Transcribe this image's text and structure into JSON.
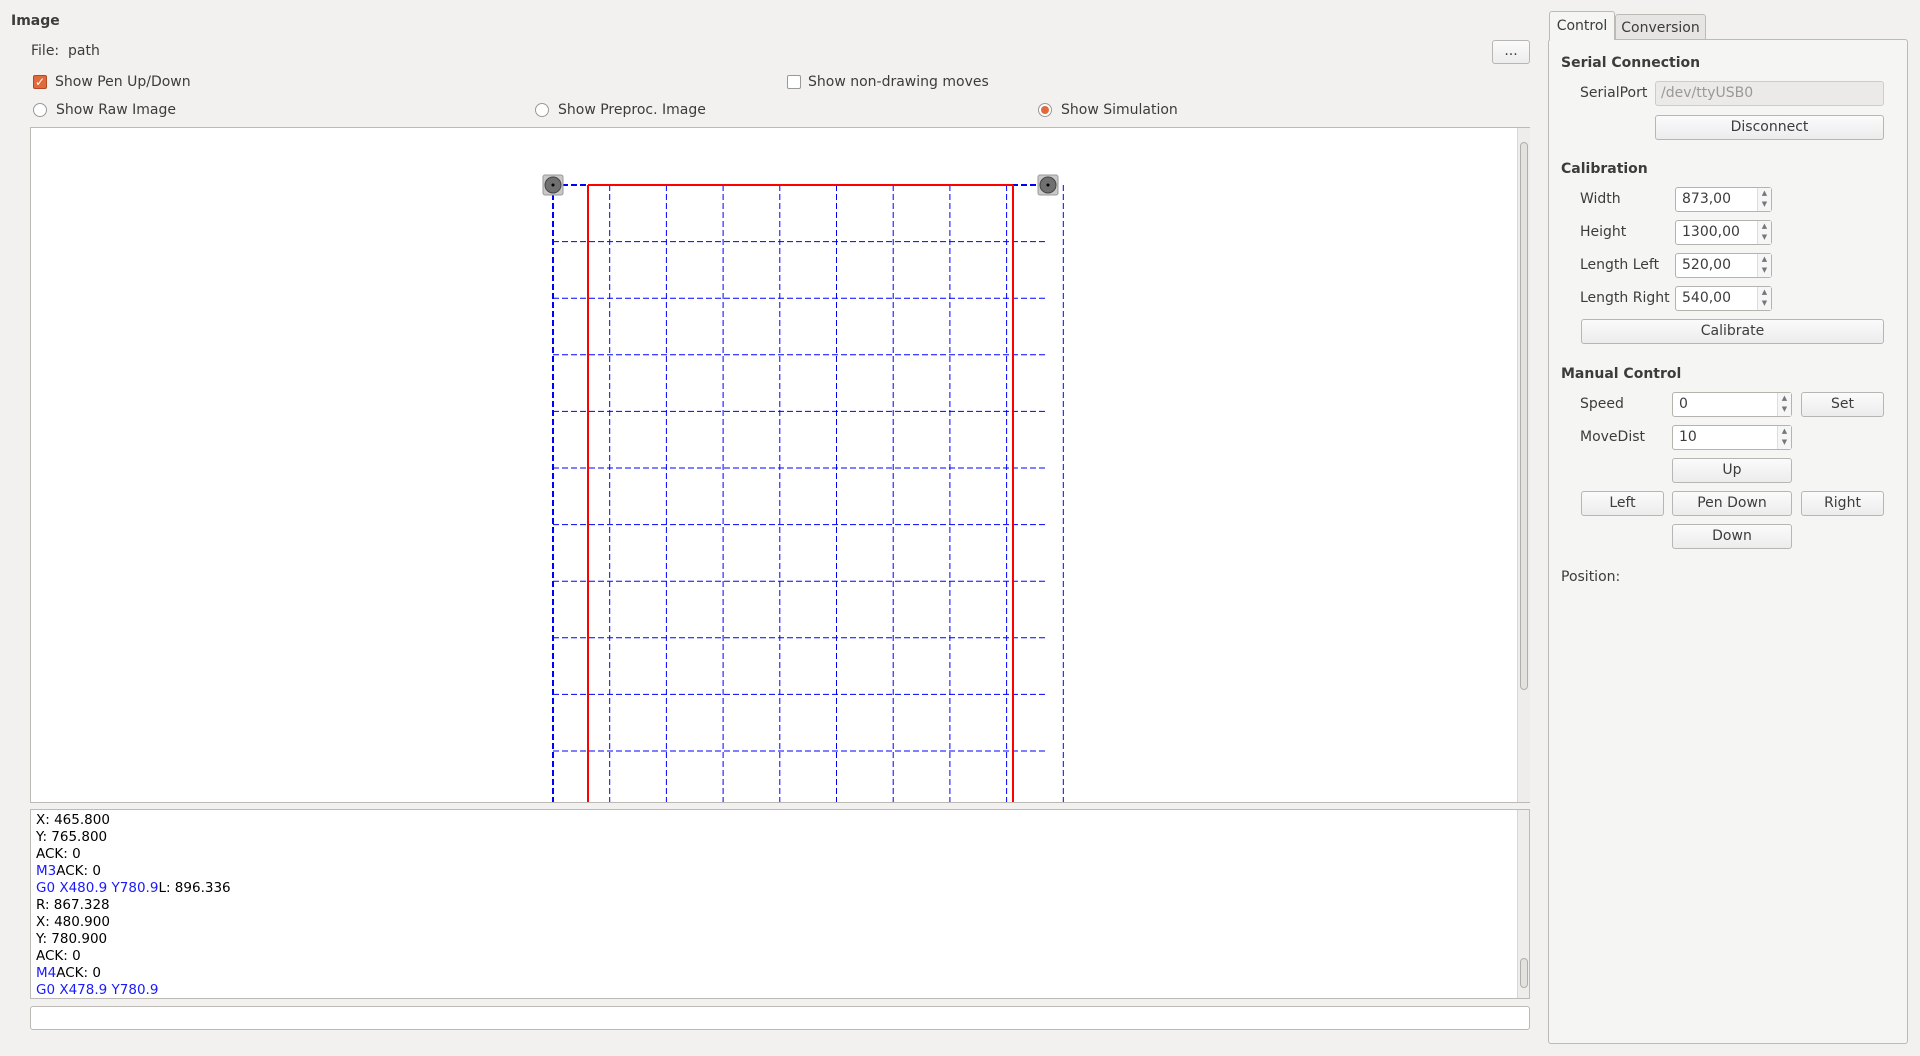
{
  "image_group": {
    "title": "Image",
    "file_label": "File:",
    "file_value": "path",
    "browse_label": "...",
    "show_pen_label": "Show Pen Up/Down",
    "show_pen_checked": true,
    "show_nondrawing_label": "Show non-drawing moves",
    "show_nondrawing_checked": false,
    "radios": [
      {
        "label": "Show Raw Image",
        "checked": false
      },
      {
        "label": "Show Preproc. Image",
        "checked": false
      },
      {
        "label": "Show Simulation",
        "checked": true
      }
    ]
  },
  "log": [
    [
      {
        "t": "X:   465.800",
        "c": "k"
      }
    ],
    [
      {
        "t": "Y:   765.800",
        "c": "k"
      }
    ],
    [
      {
        "t": "ACK: 0",
        "c": "k"
      }
    ],
    [
      {
        "t": "M3",
        "c": "b"
      },
      {
        "t": "ACK: 0",
        "c": "k"
      }
    ],
    [
      {
        "t": "G0 X480.9 Y780.9",
        "c": "b"
      },
      {
        "t": "L:   896.336",
        "c": "k"
      }
    ],
    [
      {
        "t": "R:   867.328",
        "c": "k"
      }
    ],
    [
      {
        "t": "X:   480.900",
        "c": "k"
      }
    ],
    [
      {
        "t": "Y:   780.900",
        "c": "k"
      }
    ],
    [
      {
        "t": "ACK: 0",
        "c": "k"
      }
    ],
    [
      {
        "t": "M4",
        "c": "b"
      },
      {
        "t": "ACK: 0",
        "c": "k"
      }
    ],
    [
      {
        "t": "G0 X478.9 Y780.9",
        "c": "b"
      }
    ]
  ],
  "command_input": {
    "value": ""
  },
  "tabs": [
    {
      "label": "Control",
      "active": true
    },
    {
      "label": "Conversion",
      "active": false
    }
  ],
  "serial": {
    "title": "Serial Connection",
    "port_label": "SerialPort",
    "port_value": "/dev/ttyUSB0",
    "disconnect": "Disconnect"
  },
  "calibration": {
    "title": "Calibration",
    "width_label": "Width",
    "width": "873,00",
    "height_label": "Height",
    "height": "1300,00",
    "left_label": "Length Left",
    "left": "520,00",
    "right_label": "Length Right",
    "right": "540,00",
    "calibrate": "Calibrate"
  },
  "manual": {
    "title": "Manual Control",
    "speed_label": "Speed",
    "speed": "0",
    "set": "Set",
    "movedist_label": "MoveDist",
    "movedist": "10",
    "up": "Up",
    "left": "Left",
    "pen_down": "Pen Down",
    "right": "Right",
    "down": "Down",
    "position_label": "Position:"
  },
  "colors": {
    "accent": "#e06a3c",
    "pen_path": "#ff0000",
    "move_path": "#0000ff"
  }
}
